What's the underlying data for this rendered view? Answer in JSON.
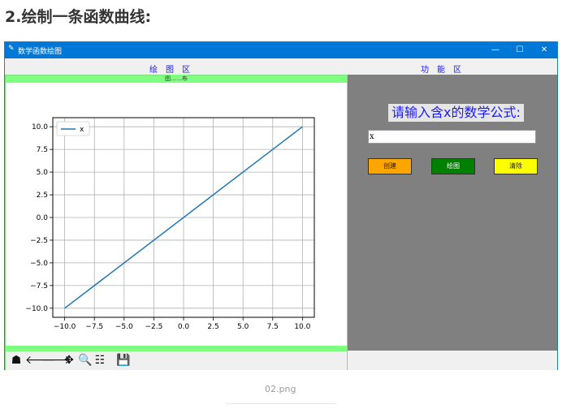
{
  "page": {
    "heading": "2.绘制一条函数曲线:",
    "caption": "02.png"
  },
  "window": {
    "title": "数学函数绘图",
    "min_glyph": "—",
    "max_glyph": "☐",
    "close_glyph": "✕"
  },
  "sections": {
    "left": "绘图区",
    "right": "功能区"
  },
  "canvas": {
    "label": "图……布"
  },
  "form": {
    "prompt": "请输入含x的数学公式:",
    "formula_value": "x",
    "create_label": "创建",
    "draw_label": "绘图",
    "clear_label": "清除"
  },
  "toolbar": {
    "home": "☗",
    "back": "🡐",
    "forward": "🡒",
    "pan": "✥",
    "zoom": "🔍",
    "configure": "☷",
    "save": "💾"
  },
  "colors": {
    "titlebar": "#0078d7",
    "accent_blue": "#1a1aff",
    "panel_gray": "#808080",
    "canvas_green": "#7fff7f",
    "line_blue": "#1f77b4",
    "create": "#ffa500",
    "draw": "#008000",
    "clear": "#ffff00"
  },
  "chart_data": {
    "type": "line",
    "series": [
      {
        "name": "x",
        "x": [
          -10,
          10
        ],
        "y": [
          -10,
          10
        ]
      }
    ],
    "xlim": [
      -11,
      11
    ],
    "ylim": [
      -11,
      11
    ],
    "xticks": [
      -10.0,
      -7.5,
      -5.0,
      -2.5,
      0.0,
      2.5,
      5.0,
      7.5,
      10.0
    ],
    "yticks": [
      -10.0,
      -7.5,
      -5.0,
      -2.5,
      0.0,
      2.5,
      5.0,
      7.5,
      10.0
    ],
    "xtick_labels": [
      "−10.0",
      "−7.5",
      "−5.0",
      "−2.5",
      "0.0",
      "2.5",
      "5.0",
      "7.5",
      "10.0"
    ],
    "ytick_labels": [
      "−10.0",
      "−7.5",
      "−5.0",
      "−2.5",
      "0.0",
      "2.5",
      "5.0",
      "7.5",
      "10.0"
    ],
    "grid": true,
    "legend": "upper-left"
  }
}
